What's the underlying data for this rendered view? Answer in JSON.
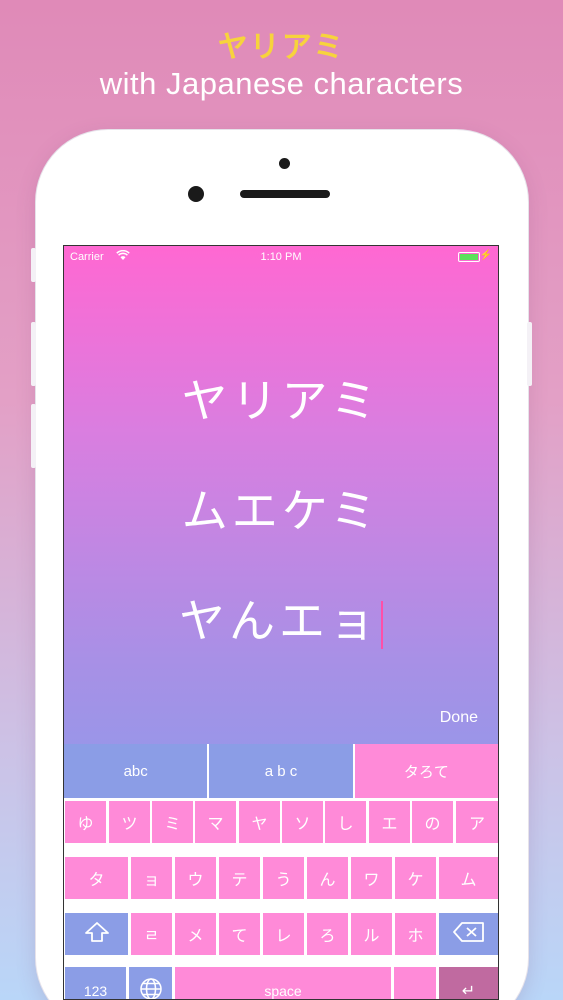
{
  "promo": {
    "title": "ヤリアミ",
    "subtitle": "with Japanese characters"
  },
  "status_bar": {
    "carrier": "Carrier",
    "time": "1:10 PM"
  },
  "text_lines": [
    "ヤリアミ",
    "ムエケミ",
    "ヤんエョ"
  ],
  "done_label": "Done",
  "keyboard": {
    "modes": [
      "abc",
      "a b c",
      "タろて"
    ],
    "row1": [
      "ゆ",
      "ツ",
      "ミ",
      "マ",
      "ヤ",
      "ソ",
      "し",
      "エ",
      "の",
      "ア"
    ],
    "row2": [
      "タ",
      "ョ",
      "ウ",
      "テ",
      "う",
      "ん",
      "ワ",
      "ケ",
      "ム"
    ],
    "row3": [
      "ㄹ",
      "メ",
      "て",
      "レ",
      "ろ",
      "ル",
      "ホ"
    ],
    "numbers_label": "123",
    "space_label": "space",
    "return_symbol": "↵"
  },
  "colors": {
    "accent_pink": "#ff8ad8",
    "key_blue": "#8b9de6",
    "title_yellow": "#f7d33c",
    "caret": "#ff4fa8"
  }
}
